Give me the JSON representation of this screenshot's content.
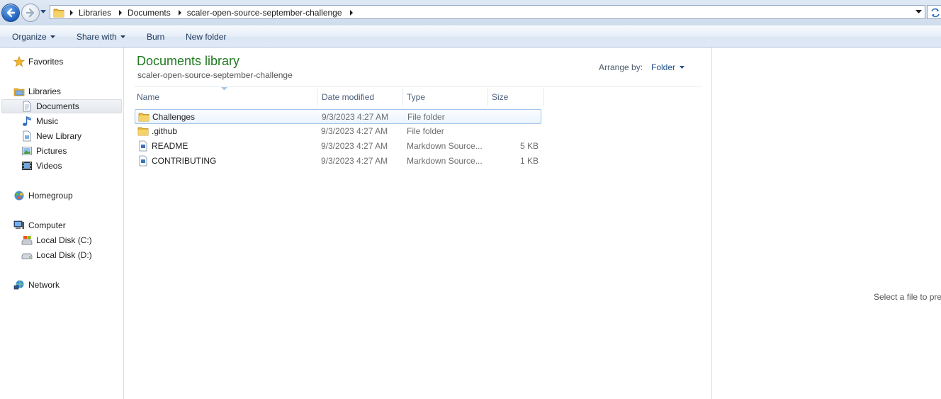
{
  "address": {
    "crumbs": [
      "Libraries",
      "Documents",
      "scaler-open-source-september-challenge"
    ]
  },
  "toolbar": {
    "organize": "Organize",
    "share_with": "Share with",
    "burn": "Burn",
    "new_folder": "New folder"
  },
  "nav": {
    "favorites": "Favorites",
    "libraries": "Libraries",
    "documents": "Documents",
    "music": "Music",
    "new_library": "New Library",
    "pictures": "Pictures",
    "videos": "Videos",
    "homegroup": "Homegroup",
    "computer": "Computer",
    "local_c": "Local Disk (C:)",
    "local_d": "Local Disk (D:)",
    "network": "Network"
  },
  "library": {
    "title": "Documents library",
    "subtitle": "scaler-open-source-september-challenge",
    "arrange_label": "Arrange by:",
    "arrange_value": "Folder"
  },
  "columns": {
    "name": "Name",
    "date": "Date modified",
    "type": "Type",
    "size": "Size"
  },
  "files": [
    {
      "name": "Challenges",
      "date": "9/3/2023 4:27 AM",
      "type": "File folder",
      "size": "",
      "icon": "folder-icon"
    },
    {
      "name": ".github",
      "date": "9/3/2023 4:27 AM",
      "type": "File folder",
      "size": "",
      "icon": "folder-icon"
    },
    {
      "name": "README",
      "date": "9/3/2023 4:27 AM",
      "type": "Markdown Source...",
      "size": "5 KB",
      "icon": "markdown-file-icon"
    },
    {
      "name": "CONTRIBUTING",
      "date": "9/3/2023 4:27 AM",
      "type": "Markdown Source...",
      "size": "1 KB",
      "icon": "markdown-file-icon"
    }
  ],
  "preview": {
    "message": "Select a file to prev"
  },
  "colors": {
    "library_title": "#1e7a1e",
    "selection_border": "#9fc3e9",
    "toolbar_text": "#1e395b"
  }
}
